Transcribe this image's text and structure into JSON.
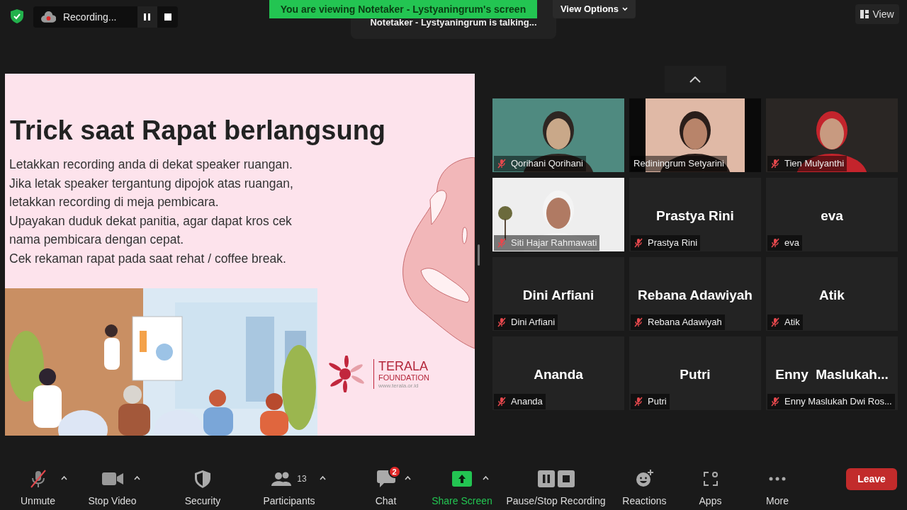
{
  "top_bar": {
    "recording": {
      "label": "Recording..."
    },
    "banner": "You are viewing Notetaker - Lystyaningrum's screen",
    "view_options": "View Options",
    "talking": "Notetaker - Lystyaningrum is talking...",
    "view_button": "View"
  },
  "slide": {
    "title": "Trick saat Rapat berlangsung",
    "lines": [
      "Letakkan recording anda di dekat speaker ruangan.",
      "Jika letak speaker tergantung dipojok atas ruangan,",
      "letakkan recording di meja pembicara.",
      "Upayakan duduk dekat panitia, agar dapat kros cek",
      "nama pembicara dengan cepat.",
      "Cek rekaman rapat pada saat rehat / coffee break."
    ],
    "logo": {
      "name": "TERALA",
      "sub": "FOUNDATION",
      "url": "www.terala.or.id"
    }
  },
  "participants": [
    {
      "kind": "video",
      "name": "Qorihani Qorihani",
      "muted": true
    },
    {
      "kind": "video",
      "name": "Rediningrum Setyarini",
      "muted": false
    },
    {
      "kind": "video",
      "name": "Tien Mulyanthi",
      "muted": true
    },
    {
      "kind": "video",
      "name": "Siti Hajar Rahmawati",
      "muted": true
    },
    {
      "kind": "name",
      "display": "Prastya Rini",
      "name": "Prastya Rini",
      "muted": true
    },
    {
      "kind": "name",
      "display": "eva",
      "name": "eva",
      "muted": true
    },
    {
      "kind": "name",
      "display": "Dini Arfiani",
      "name": "Dini Arfiani",
      "muted": true
    },
    {
      "kind": "name",
      "display": "Rebana Adawiyah",
      "name": "Rebana Adawiyah",
      "muted": true
    },
    {
      "kind": "name",
      "display": "Atik",
      "name": "Atik",
      "muted": true
    },
    {
      "kind": "name",
      "display": "Ananda",
      "name": "Ananda",
      "muted": true
    },
    {
      "kind": "name",
      "display": "Putri",
      "name": "Putri",
      "muted": true
    },
    {
      "kind": "name",
      "display": "Enny  Maslukah...",
      "name": "Enny Maslukah Dwi Ros...",
      "muted": true
    }
  ],
  "toolbar": [
    {
      "kind": "mic",
      "label": "Unmute",
      "muted": true,
      "caret": true
    },
    {
      "kind": "video",
      "label": "Stop Video",
      "caret": true
    },
    {
      "kind": "security",
      "label": "Security",
      "caret": false
    },
    {
      "kind": "participants",
      "label": "Participants",
      "count": "13",
      "caret": true
    },
    {
      "kind": "chat",
      "label": "Chat",
      "badge": "2",
      "caret": true
    },
    {
      "kind": "share",
      "label": "Share Screen",
      "caret": true
    },
    {
      "kind": "record",
      "label": "Pause/Stop Recording",
      "caret": false
    },
    {
      "kind": "reactions",
      "label": "Reactions",
      "caret": false
    },
    {
      "kind": "apps",
      "label": "Apps",
      "caret": false
    },
    {
      "kind": "more",
      "label": "More",
      "caret": false
    }
  ],
  "leave_button": "Leave"
}
